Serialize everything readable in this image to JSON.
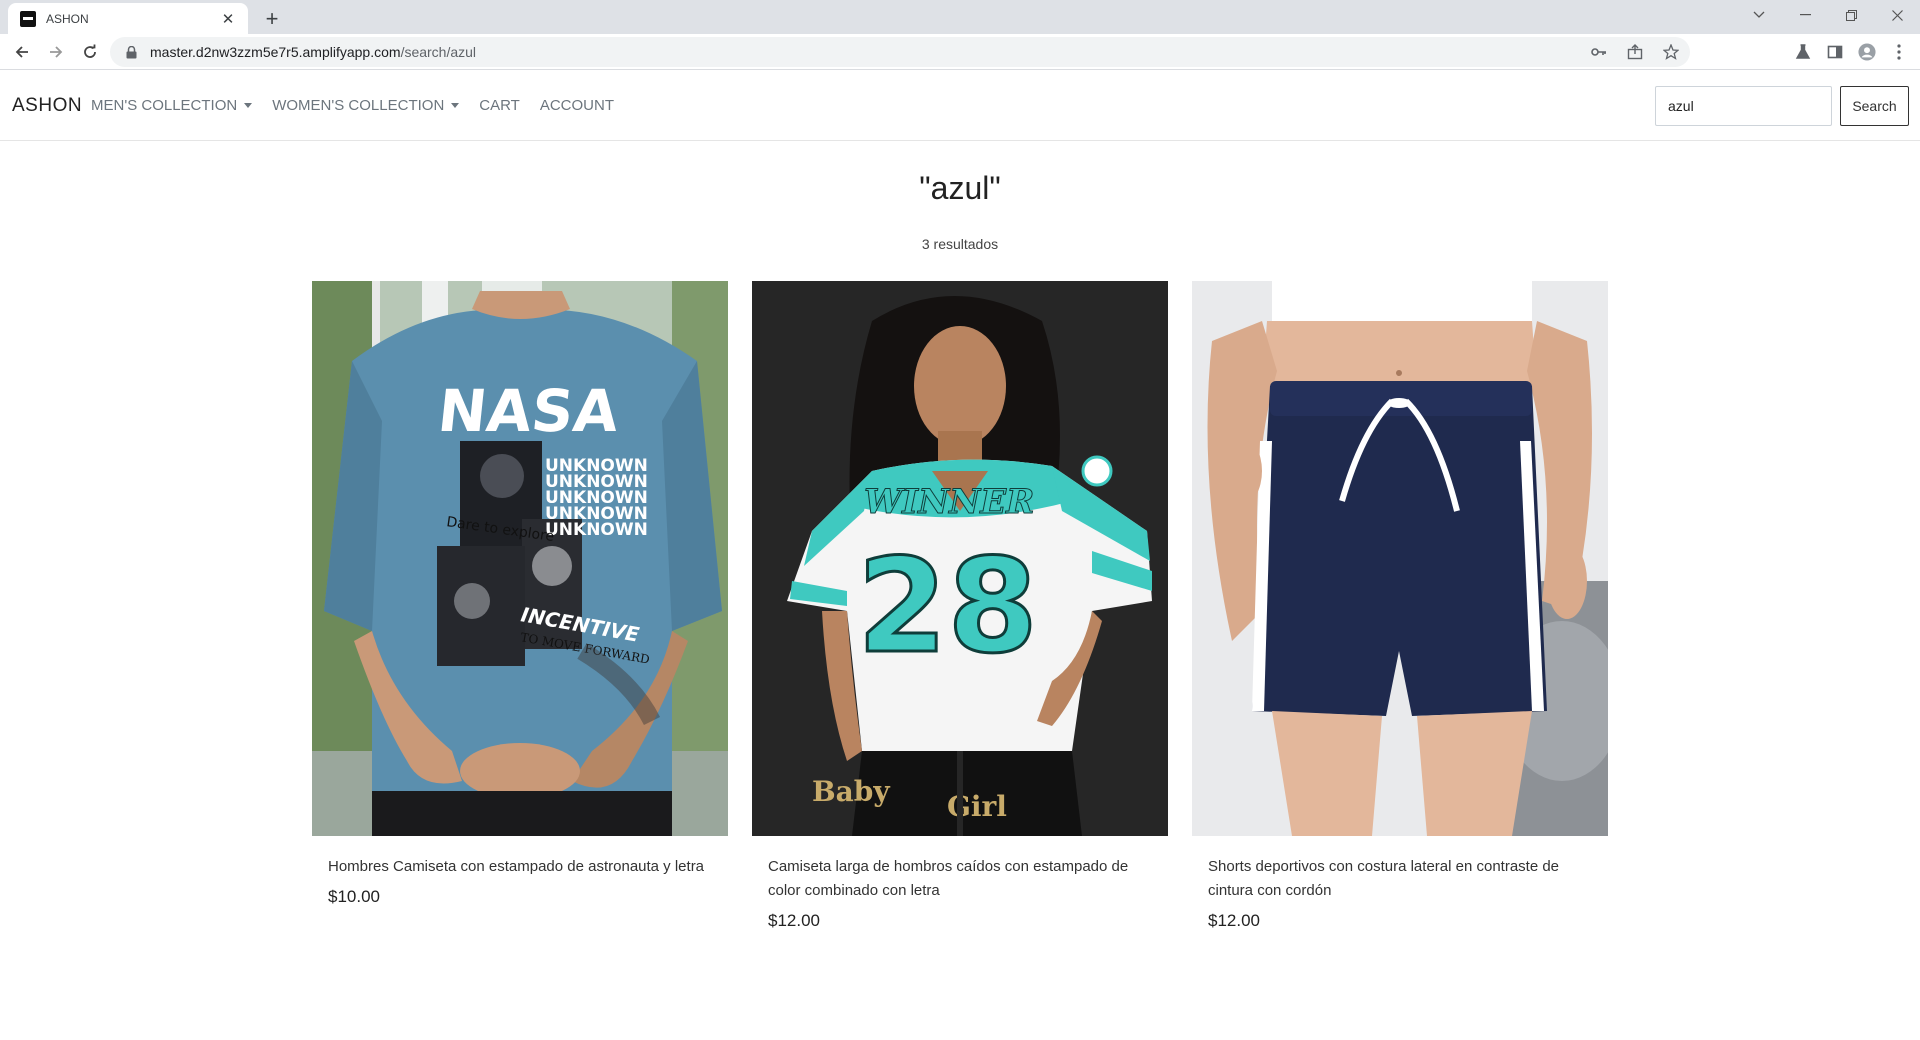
{
  "browser": {
    "tab_title": "ASHON",
    "url_host": "master.d2nw3zzm5e7r5.amplifyapp.com",
    "url_path": "/search/azul"
  },
  "site": {
    "brand": "ASHON",
    "nav": [
      {
        "label": "MEN'S COLLECTION",
        "dropdown": true
      },
      {
        "label": "WOMEN'S COLLECTION",
        "dropdown": true
      },
      {
        "label": "CART",
        "dropdown": false
      },
      {
        "label": "ACCOUNT",
        "dropdown": false
      }
    ],
    "search": {
      "value": "azul",
      "button_label": "Search"
    }
  },
  "results": {
    "title": "\"azul\"",
    "count": "3 resultados"
  },
  "products": [
    {
      "name": "Hombres Camiseta con estampado de astronauta y letra",
      "price": "$10.00",
      "image": "blue-nasa-tshirt-back",
      "print_text": {
        "logo": "NASA",
        "unknown": "UNKNOWN",
        "dare": "Dare to explore",
        "incentive": "INCENTIVE",
        "move": "TO MOVE FORWARD"
      }
    },
    {
      "name": "Camiseta larga de hombros caídos con estampado de color combinado con letra",
      "price": "$12.00",
      "image": "winner-28-jersey-tee",
      "print_text": {
        "word": "WINNER",
        "number": "28",
        "shorts_left": "Baby",
        "shorts_right": "Girl"
      }
    },
    {
      "name": "Shorts deportivos con costura lateral en contraste de cintura con cordón",
      "price": "$12.00",
      "image": "navy-drawstring-shorts"
    }
  ],
  "colors": {
    "tee_blue": "#5b8fae",
    "jersey_teal": "#3fc9c0",
    "shorts_navy": "#1f2a4e"
  }
}
